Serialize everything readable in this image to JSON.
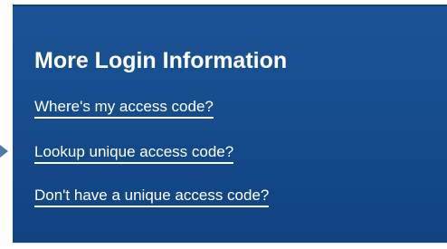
{
  "panel": {
    "title": "More Login Information",
    "links": [
      {
        "label": "Where's my access code?"
      },
      {
        "label": "Lookup unique access code?"
      },
      {
        "label": "Don't have a unique access code?"
      }
    ]
  },
  "colors": {
    "panel_background": "#154b8b",
    "text": "#ffffff",
    "pointer": "#4f77a8"
  },
  "icons": {
    "pointer": "caret-right-icon"
  }
}
